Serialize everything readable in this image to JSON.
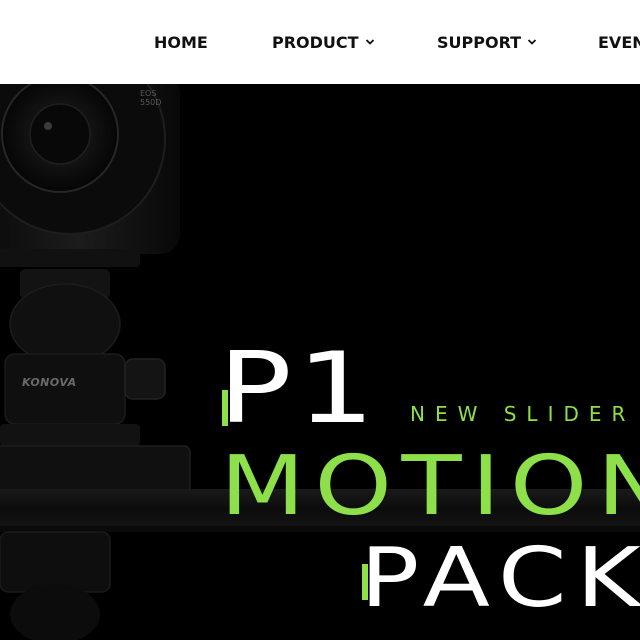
{
  "nav": {
    "items": [
      {
        "label": "HOME",
        "has_dropdown": false
      },
      {
        "label": "PRODUCT",
        "has_dropdown": true
      },
      {
        "label": "SUPPORT",
        "has_dropdown": true
      },
      {
        "label": "EVEN",
        "has_dropdown": false
      }
    ]
  },
  "hero": {
    "model": "P1",
    "tagline": "NEW SLIDER",
    "line1": "MOTION",
    "line2": "PACK",
    "brand_on_product": "KONOVA",
    "camera_badge": "EOS 550D",
    "accent_color": "#8ee04a"
  }
}
